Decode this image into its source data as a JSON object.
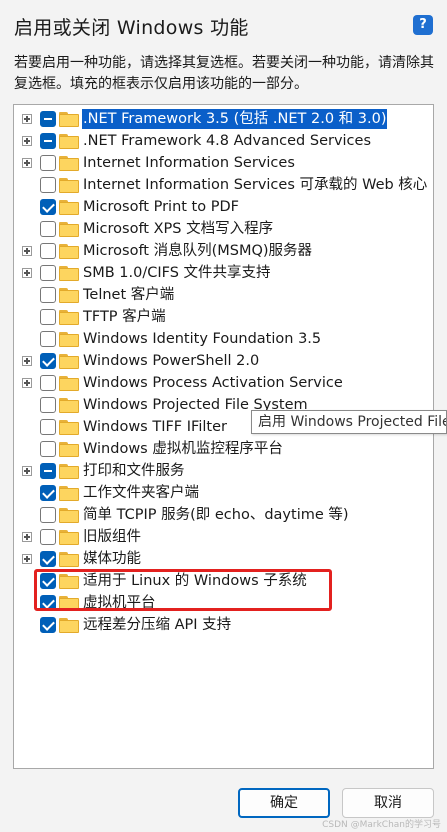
{
  "window": {
    "title": "启用或关闭 Windows 功能",
    "help_label": "?"
  },
  "description": "若要启用一种功能，请选择其复选框。若要关闭一种功能，请清除其复选框。填充的框表示仅启用该功能的一部分。",
  "features": [
    {
      "label": ".NET Framework 3.5 (包括 .NET 2.0 和 3.0)",
      "state": "partial",
      "expandable": true,
      "selected": true
    },
    {
      "label": ".NET Framework 4.8 Advanced Services",
      "state": "partial",
      "expandable": true,
      "selected": false
    },
    {
      "label": "Internet Information Services",
      "state": "unchecked",
      "expandable": true,
      "selected": false
    },
    {
      "label": "Internet Information Services 可承载的 Web 核心",
      "state": "unchecked",
      "expandable": false,
      "selected": false
    },
    {
      "label": "Microsoft Print to PDF",
      "state": "checked",
      "expandable": false,
      "selected": false
    },
    {
      "label": "Microsoft XPS 文档写入程序",
      "state": "unchecked",
      "expandable": false,
      "selected": false
    },
    {
      "label": "Microsoft 消息队列(MSMQ)服务器",
      "state": "unchecked",
      "expandable": true,
      "selected": false
    },
    {
      "label": "SMB 1.0/CIFS 文件共享支持",
      "state": "unchecked",
      "expandable": true,
      "selected": false
    },
    {
      "label": "Telnet 客户端",
      "state": "unchecked",
      "expandable": false,
      "selected": false
    },
    {
      "label": "TFTP 客户端",
      "state": "unchecked",
      "expandable": false,
      "selected": false
    },
    {
      "label": "Windows Identity Foundation 3.5",
      "state": "unchecked",
      "expandable": false,
      "selected": false
    },
    {
      "label": "Windows PowerShell 2.0",
      "state": "checked",
      "expandable": true,
      "selected": false
    },
    {
      "label": "Windows Process Activation Service",
      "state": "unchecked",
      "expandable": true,
      "selected": false
    },
    {
      "label": "Windows Projected File System",
      "state": "unchecked",
      "expandable": false,
      "selected": false
    },
    {
      "label": "Windows TIFF IFilter",
      "state": "unchecked",
      "expandable": false,
      "selected": false
    },
    {
      "label": "Windows 虚拟机监控程序平台",
      "state": "unchecked",
      "expandable": false,
      "selected": false
    },
    {
      "label": "打印和文件服务",
      "state": "partial",
      "expandable": true,
      "selected": false
    },
    {
      "label": "工作文件夹客户端",
      "state": "checked",
      "expandable": false,
      "selected": false
    },
    {
      "label": "简单 TCPIP 服务(即 echo、daytime 等)",
      "state": "unchecked",
      "expandable": false,
      "selected": false
    },
    {
      "label": "旧版组件",
      "state": "unchecked",
      "expandable": true,
      "selected": false
    },
    {
      "label": "媒体功能",
      "state": "checked",
      "expandable": true,
      "selected": false
    },
    {
      "label": "适用于 Linux 的 Windows 子系统",
      "state": "checked",
      "expandable": false,
      "selected": false
    },
    {
      "label": "虚拟机平台",
      "state": "checked",
      "expandable": false,
      "selected": false
    },
    {
      "label": "远程差分压缩 API 支持",
      "state": "checked",
      "expandable": false,
      "selected": false
    }
  ],
  "tooltip": "启用 Windows Projected File System",
  "buttons": {
    "ok": "确定",
    "cancel": "取消"
  },
  "watermark": "CSDN @MarkChan的学习号",
  "colors": {
    "accent": "#005fb8",
    "highlight_box": "#e3211f",
    "folder": "#fdd55f"
  }
}
